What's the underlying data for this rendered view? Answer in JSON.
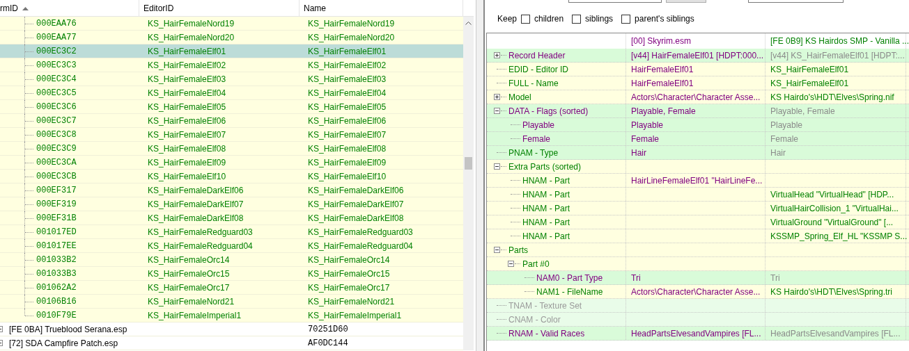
{
  "records_table": {
    "columns": [
      {
        "label": "rmID",
        "sorted_ascending": true
      },
      {
        "label": "EditorID"
      },
      {
        "label": "Name"
      }
    ],
    "records": [
      {
        "form_id": "000EAA76",
        "editor_id": "KS_HairFemaleNord19",
        "name": "KS_HairFemaleNord19",
        "selected": false
      },
      {
        "form_id": "000EAA77",
        "editor_id": "KS_HairFemaleNord20",
        "name": "KS_HairFemaleNord20",
        "selected": false
      },
      {
        "form_id": "000EC3C2",
        "editor_id": "KS_HairFemaleElf01",
        "name": "KS_HairFemaleElf01",
        "selected": true
      },
      {
        "form_id": "000EC3C3",
        "editor_id": "KS_HairFemaleElf02",
        "name": "KS_HairFemaleElf02",
        "selected": false
      },
      {
        "form_id": "000EC3C4",
        "editor_id": "KS_HairFemaleElf03",
        "name": "KS_HairFemaleElf03",
        "selected": false
      },
      {
        "form_id": "000EC3C5",
        "editor_id": "KS_HairFemaleElf04",
        "name": "KS_HairFemaleElf04",
        "selected": false
      },
      {
        "form_id": "000EC3C6",
        "editor_id": "KS_HairFemaleElf05",
        "name": "KS_HairFemaleElf05",
        "selected": false
      },
      {
        "form_id": "000EC3C7",
        "editor_id": "KS_HairFemaleElf06",
        "name": "KS_HairFemaleElf06",
        "selected": false
      },
      {
        "form_id": "000EC3C8",
        "editor_id": "KS_HairFemaleElf07",
        "name": "KS_HairFemaleElf07",
        "selected": false
      },
      {
        "form_id": "000EC3C9",
        "editor_id": "KS_HairFemaleElf08",
        "name": "KS_HairFemaleElf08",
        "selected": false
      },
      {
        "form_id": "000EC3CA",
        "editor_id": "KS_HairFemaleElf09",
        "name": "KS_HairFemaleElf09",
        "selected": false
      },
      {
        "form_id": "000EC3CB",
        "editor_id": "KS_HairFemaleElf10",
        "name": "KS_HairFemaleElf10",
        "selected": false
      },
      {
        "form_id": "000EF317",
        "editor_id": "KS_HairFemaleDarkElf06",
        "name": "KS_HairFemaleDarkElf06",
        "selected": false
      },
      {
        "form_id": "000EF319",
        "editor_id": "KS_HairFemaleDarkElf07",
        "name": "KS_HairFemaleDarkElf07",
        "selected": false
      },
      {
        "form_id": "000EF31B",
        "editor_id": "KS_HairFemaleDarkElf08",
        "name": "KS_HairFemaleDarkElf08",
        "selected": false
      },
      {
        "form_id": "001017ED",
        "editor_id": "KS_HairFemaleRedguard03",
        "name": "KS_HairFemaleRedguard03",
        "selected": false
      },
      {
        "form_id": "001017EE",
        "editor_id": "KS_HairFemaleRedguard04",
        "name": "KS_HairFemaleRedguard04",
        "selected": false
      },
      {
        "form_id": "001033B2",
        "editor_id": "KS_HairFemaleOrc14",
        "name": "KS_HairFemaleOrc14",
        "selected": false
      },
      {
        "form_id": "001033B3",
        "editor_id": "KS_HairFemaleOrc15",
        "name": "KS_HairFemaleOrc15",
        "selected": false
      },
      {
        "form_id": "001062A2",
        "editor_id": "KS_HairFemaleOrc17",
        "name": "KS_HairFemaleOrc17",
        "selected": false
      },
      {
        "form_id": "00106B16",
        "editor_id": "KS_HairFemaleNord21",
        "name": "KS_HairFemaleNord21",
        "selected": false
      },
      {
        "form_id": "0010F79E",
        "editor_id": "KS_HairFemaleImperial1",
        "name": "KS_HairFemaleImperial1",
        "selected": false
      }
    ],
    "plugins": [
      {
        "label": "[FE 0BA] Trueblood Serana.esp",
        "name": "70251D60"
      },
      {
        "label": "[72] SDA Campfire Patch.esp",
        "name": "AF0DC144"
      }
    ]
  },
  "keep": {
    "label": "Keep",
    "options": [
      {
        "label": "children",
        "checked": false
      },
      {
        "label": "siblings",
        "checked": false
      },
      {
        "label": "parent's siblings",
        "checked": false
      }
    ]
  },
  "record_view": {
    "columns": [
      {
        "text": "[00] Skyrim.esm",
        "color": "#800080"
      },
      {
        "text": "[FE 0B9] KS Hairdos SMP - Vanilla ...",
        "color": "#008000"
      }
    ],
    "rows": [
      {
        "label": {
          "text": "Record Header",
          "color": "#800080"
        },
        "color": "#d9fbd9",
        "expanded": false,
        "master_value": {
          "text": "[v44] HairFemaleElf01 [HDPT:000...",
          "color": "#800080"
        },
        "override_value": {
          "text": "[v44] KS_HairFemaleElf01 [HDPT:...",
          "color": "#8a8a8a"
        }
      },
      {
        "label": {
          "text": "EDID - Editor ID",
          "color": "#008000"
        },
        "color": "#ffffe0",
        "master_value": {
          "text": "HairFemaleElf01",
          "color": "#800080"
        },
        "override_value": {
          "text": "KS_HairFemaleElf01",
          "color": "#008000"
        }
      },
      {
        "label": {
          "text": "FULL - Name",
          "color": "#008000"
        },
        "color": "#ffffe0",
        "master_value": {
          "text": "HairFemaleElf01",
          "color": "#800080"
        },
        "override_value": {
          "text": "KS_HairFemaleElf01",
          "color": "#008000"
        }
      },
      {
        "label": {
          "text": "Model",
          "color": "#008000"
        },
        "color": "#ffffe0",
        "expanded": false,
        "master_value": {
          "text": "Actors\\Character\\Character Asse...",
          "color": "#800080"
        },
        "override_value": {
          "text": "KS Hairdo's\\HDT\\Elves\\Spring.nif",
          "color": "#008000"
        }
      },
      {
        "label": {
          "text": "DATA - Flags (sorted)",
          "color": "#800080"
        },
        "color": "#d9fbd9",
        "expanded": true,
        "master_value": {
          "text": "Playable, Female",
          "color": "#800080"
        },
        "override_value": {
          "text": "Playable, Female",
          "color": "#8a8a8a"
        },
        "children": [
          {
            "label": {
              "text": "Playable",
              "color": "#800080"
            },
            "color": "#d9fbd9",
            "master_value": {
              "text": "Playable",
              "color": "#800080"
            },
            "override_value": {
              "text": "Playable",
              "color": "#8a8a8a"
            }
          },
          {
            "label": {
              "text": "Female",
              "color": "#800080"
            },
            "color": "#d9fbd9",
            "master_value": {
              "text": "Female",
              "color": "#800080"
            },
            "override_value": {
              "text": "Female",
              "color": "#8a8a8a"
            }
          }
        ]
      },
      {
        "label": {
          "text": "PNAM - Type",
          "color": "#008000"
        },
        "color": "#d9fbd9",
        "master_value": {
          "text": "Hair",
          "color": "#800080"
        },
        "override_value": {
          "text": "Hair",
          "color": "#8a8a8a"
        }
      },
      {
        "label": {
          "text": "Extra Parts (sorted)",
          "color": "#008000"
        },
        "color": "#ffffe0",
        "expanded": true,
        "children": [
          {
            "label": {
              "text": "HNAM - Part",
              "color": "#008000"
            },
            "color": "#ffffe0",
            "master_value": {
              "text": "HairLineFemaleElf01 \"HairLineFe...",
              "color": "#800080"
            }
          },
          {
            "label": {
              "text": "HNAM - Part",
              "color": "#008000"
            },
            "color": "#ffffe0",
            "override_value": {
              "text": "VirtualHead \"VirtualHead\" [HDP...",
              "color": "#008000"
            }
          },
          {
            "label": {
              "text": "HNAM - Part",
              "color": "#008000"
            },
            "color": "#ffffe0",
            "override_value": {
              "text": "VirtualHairCollision_1 \"VirtualHai...",
              "color": "#008000"
            }
          },
          {
            "label": {
              "text": "HNAM - Part",
              "color": "#008000"
            },
            "color": "#ffffe0",
            "override_value": {
              "text": "VirtualGround \"VirtualGround\" [...",
              "color": "#008000"
            }
          },
          {
            "label": {
              "text": "HNAM - Part",
              "color": "#008000"
            },
            "color": "#ffffe0",
            "override_value": {
              "text": "KSSMP_Spring_Elf_HL \"KSSMP S...",
              "color": "#008000"
            }
          }
        ]
      },
      {
        "label": {
          "text": "Parts",
          "color": "#008000"
        },
        "color": "#ffffe0",
        "expanded": true,
        "children": [
          {
            "label": {
              "text": "Part #0",
              "color": "#008000"
            },
            "color": "#ffffe0",
            "expanded": true,
            "children": [
              {
                "label": {
                  "text": "NAM0 - Part Type",
                  "color": "#800080"
                },
                "color": "#d9fbd9",
                "master_value": {
                  "text": "Tri",
                  "color": "#800080"
                },
                "override_value": {
                  "text": "Tri",
                  "color": "#8a8a8a"
                }
              },
              {
                "label": {
                  "text": "NAM1 - FileName",
                  "color": "#008000"
                },
                "color": "#ffffe0",
                "master_value": {
                  "text": "Actors\\Character\\Character Asse...",
                  "color": "#800080"
                },
                "override_value": {
                  "text": "KS Hairdo's\\HDT\\Elves\\Spring.tri",
                  "color": "#008000"
                }
              }
            ]
          }
        ]
      },
      {
        "label": {
          "text": "TNAM - Texture Set",
          "color": "#9a9a9a"
        },
        "color": "#e9fce9"
      },
      {
        "label": {
          "text": "CNAM - Color",
          "color": "#9a9a9a"
        },
        "color": "#e9fce9"
      },
      {
        "label": {
          "text": "RNAM - Valid Races",
          "color": "#800080"
        },
        "color": "#d9fbd9",
        "master_value": {
          "text": "HeadPartsElvesandVampires [FL...",
          "color": "#800080"
        },
        "override_value": {
          "text": "HeadPartsElvesandVampires [FL...",
          "color": "#8a8a8a"
        }
      }
    ]
  }
}
